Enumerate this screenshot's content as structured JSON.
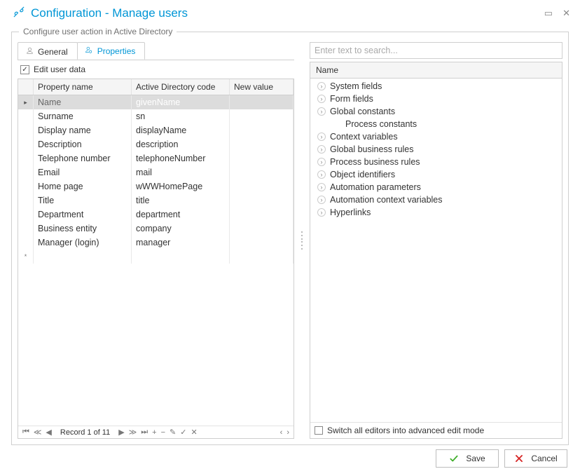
{
  "titlebar": {
    "title": "Configuration - Manage users"
  },
  "group": {
    "legend": "Configure user action in Active Directory"
  },
  "tabs": {
    "general": "General",
    "properties": "Properties"
  },
  "edit_checkbox": {
    "label": "Edit user data",
    "checked": true
  },
  "grid": {
    "columns": {
      "prop": "Property name",
      "ad": "Active Directory code",
      "new": "New value"
    },
    "rows": [
      {
        "ind": "▸",
        "prop": "Name",
        "ad": "givenName",
        "new": "",
        "selected": true
      },
      {
        "ind": "",
        "prop": "Surname",
        "ad": "sn",
        "new": ""
      },
      {
        "ind": "",
        "prop": "Display name",
        "ad": "displayName",
        "new": ""
      },
      {
        "ind": "",
        "prop": "Description",
        "ad": "description",
        "new": ""
      },
      {
        "ind": "",
        "prop": "Telephone number",
        "ad": "telephoneNumber",
        "new": ""
      },
      {
        "ind": "",
        "prop": "Email",
        "ad": "mail",
        "new": ""
      },
      {
        "ind": "",
        "prop": "Home page",
        "ad": "wWWHomePage",
        "new": ""
      },
      {
        "ind": "",
        "prop": "Title",
        "ad": "title",
        "new": ""
      },
      {
        "ind": "",
        "prop": "Department",
        "ad": "department",
        "new": ""
      },
      {
        "ind": "",
        "prop": "Business entity",
        "ad": "company",
        "new": ""
      },
      {
        "ind": "",
        "prop": "Manager (login)",
        "ad": "manager",
        "new": ""
      }
    ],
    "newrow_mark": "*",
    "recnav": {
      "text": "Record 1 of 11",
      "glyphs": {
        "first": "⏮",
        "prevpg": "◀◀",
        "prev": "◀",
        "next": "▶",
        "nextpg": "▶▶",
        "last": "⏭",
        "plus": "+",
        "minus": "−",
        "edit": "✎",
        "commit": "✓",
        "cancel": "✕",
        "left": "‹",
        "right": "›"
      }
    }
  },
  "right": {
    "search_placeholder": "Enter text to search...",
    "tree_header": "Name",
    "tree": [
      {
        "label": "System fields",
        "exp": true
      },
      {
        "label": "Form fields",
        "exp": true
      },
      {
        "label": "Global constants",
        "exp": true
      },
      {
        "label": "Process constants",
        "exp": false,
        "indent": true
      },
      {
        "label": "Context variables",
        "exp": true
      },
      {
        "label": "Global business rules",
        "exp": true
      },
      {
        "label": "Process business rules",
        "exp": true
      },
      {
        "label": "Object identifiers",
        "exp": true
      },
      {
        "label": "Automation parameters",
        "exp": true
      },
      {
        "label": "Automation context variables",
        "exp": true
      },
      {
        "label": "Hyperlinks",
        "exp": true
      }
    ],
    "footer_label": "Switch all editors into advanced edit mode"
  },
  "buttons": {
    "save": "Save",
    "cancel": "Cancel"
  }
}
